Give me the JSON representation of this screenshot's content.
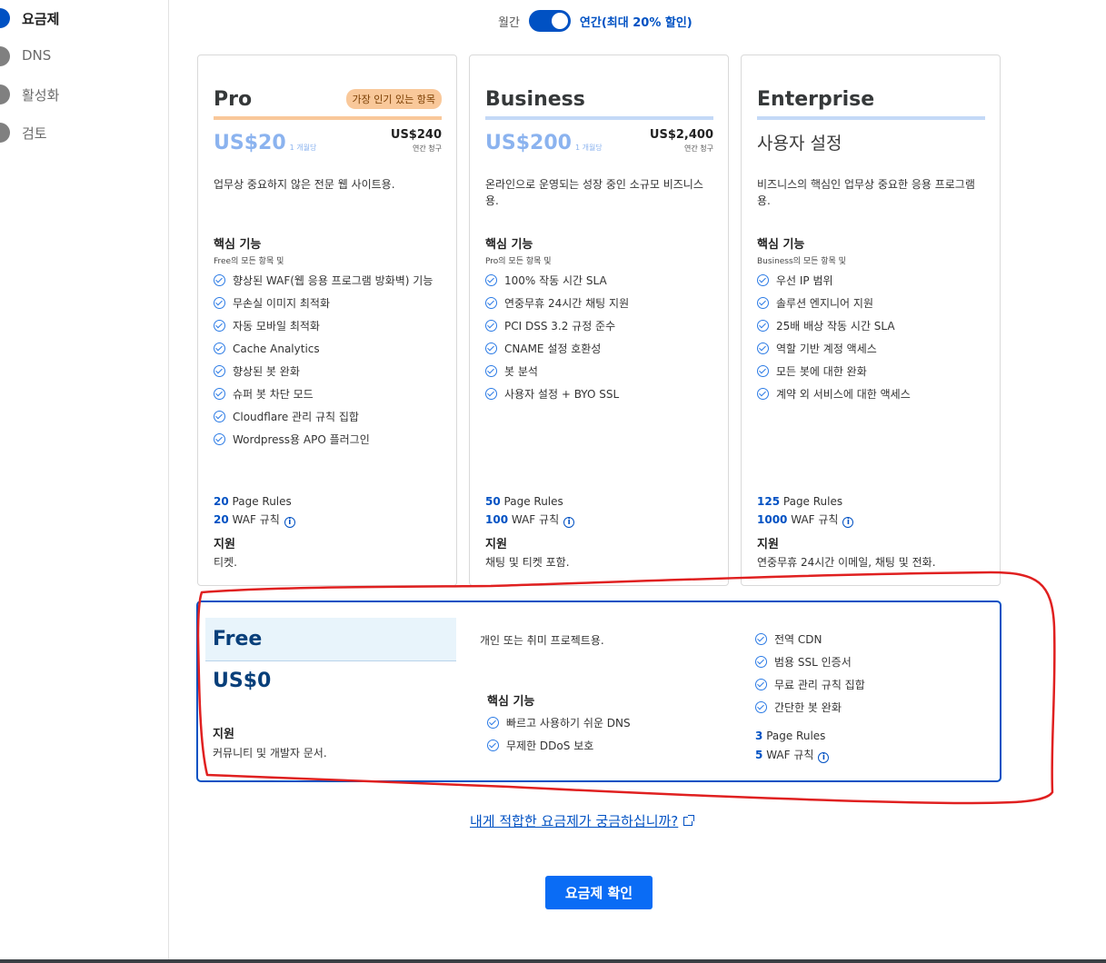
{
  "sidebar": {
    "steps": [
      {
        "label": "요금제",
        "active": true
      },
      {
        "label": "DNS",
        "active": false
      },
      {
        "label": "활성화",
        "active": false
      },
      {
        "label": "검토",
        "active": false
      }
    ]
  },
  "billing": {
    "monthly_label": "월간",
    "yearly_label": "연간(최대 20% 할인)",
    "selected": "yearly"
  },
  "plans": [
    {
      "name": "Pro",
      "badge": "가장 인기 있는 항목",
      "price": "US$20",
      "per": "1 개월당",
      "yearly_price": "US$240",
      "yearly_sub": "연간 청구",
      "description": "업무상 중요하지 않은 전문 웹 사이트용.",
      "core_label": "핵심 기능",
      "inherit": "Free의 모든 항목 및",
      "features": [
        "향상된 WAF(웹 응용 프로그램 방화벽) 기능",
        "무손실 이미지 최적화",
        "자동 모바일 최적화",
        "Cache Analytics",
        "향상된 봇 완화",
        "슈퍼 봇 차단 모드",
        "Cloudflare 관리 규칙 집합",
        "Wordpress용 APO 플러그인"
      ],
      "page_rules_num": "20",
      "page_rules_label": "Page Rules",
      "waf_num": "20",
      "waf_label": "WAF 규칙",
      "support_label": "지원",
      "support_text": "티켓."
    },
    {
      "name": "Business",
      "price": "US$200",
      "per": "1 개월당",
      "yearly_price": "US$2,400",
      "yearly_sub": "연간 청구",
      "description": "온라인으로 운영되는 성장 중인 소규모 비즈니스용.",
      "core_label": "핵심 기능",
      "inherit": "Pro의 모든 항목 및",
      "features": [
        "100% 작동 시간 SLA",
        "연중무휴 24시간 채팅 지원",
        "PCI DSS 3.2 규정 준수",
        "CNAME 설정 호환성",
        "봇 분석",
        "사용자 설정 + BYO SSL"
      ],
      "page_rules_num": "50",
      "page_rules_label": "Page Rules",
      "waf_num": "100",
      "waf_label": "WAF 규칙",
      "support_label": "지원",
      "support_text": "채팅 및 티켓 포함."
    },
    {
      "name": "Enterprise",
      "custom_price": "사용자 설정",
      "description": "비즈니스의 핵심인 업무상 중요한 응용 프로그램용.",
      "core_label": "핵심 기능",
      "inherit": "Business의 모든 항목 및",
      "features": [
        "우선 IP 범위",
        "솔루션 엔지니어 지원",
        "25배 배상 작동 시간 SLA",
        "역할 기반 계정 액세스",
        "모든 봇에 대한 완화",
        "계약 외 서비스에 대한 액세스"
      ],
      "page_rules_num": "125",
      "page_rules_label": "Page Rules",
      "waf_num": "1000",
      "waf_label": "WAF 규칙",
      "support_label": "지원",
      "support_text": "연중무휴 24시간 이메일, 채팅 및 전화."
    }
  ],
  "free": {
    "name": "Free",
    "price": "US$0",
    "support_label": "지원",
    "support_text": "커뮤니티 및 개발자 문서.",
    "description": "개인 또는 취미 프로젝트용.",
    "core_label": "핵심 기능",
    "core_features": [
      "빠르고 사용하기 쉬운 DNS",
      "무제한 DDoS 보호"
    ],
    "features": [
      "전역 CDN",
      "범용 SSL 인증서",
      "무료 관리 규칙 집합",
      "간단한 봇 완화"
    ],
    "page_rules_num": "3",
    "page_rules_label": "Page Rules",
    "waf_num": "5",
    "waf_label": "WAF 규칙"
  },
  "help_link": "내게 적합한 요금제가 궁금하십니까?",
  "confirm_button": "요금제 확인",
  "colors": {
    "accent": "#0051c3",
    "button": "#0a6cf5",
    "popular_badge": "#f9c89a",
    "annotation": "#e02020"
  },
  "icons": [
    "check-circle-icon",
    "info-icon",
    "external-link-icon"
  ]
}
